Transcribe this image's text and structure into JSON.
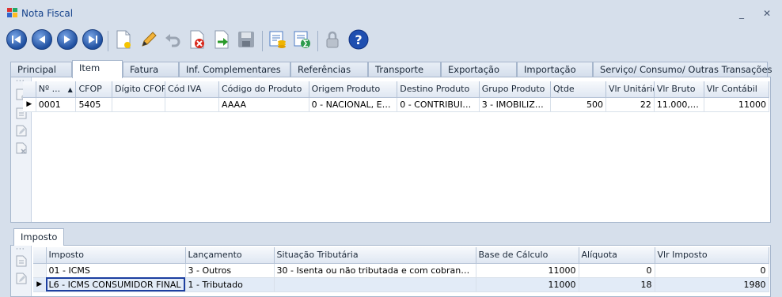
{
  "window": {
    "title": "Nota Fiscal",
    "minimize_label": "_",
    "close_label": "✕"
  },
  "toolbar": {
    "buttons": [
      "first-record",
      "previous-record",
      "next-record",
      "last-record",
      "new-document",
      "edit",
      "undo",
      "delete",
      "refresh",
      "save",
      "report",
      "report-export",
      "lock",
      "help"
    ]
  },
  "tabs": [
    "Principal",
    "Item",
    "Fatura",
    "Inf. Complementares",
    "Referências",
    "Transporte",
    "Exportação",
    "Importação",
    "Serviço/ Consumo/ Outras Transações"
  ],
  "active_tab": "Item",
  "items_grid": {
    "columns": [
      "Nº ...",
      "CFOP",
      "Dígito CFOP",
      "Cód IVA",
      "Código do Produto",
      "Origem Produto",
      "Destino Produto",
      "Grupo Produto",
      "Qtde",
      "Vlr Unitário",
      "Vlr Bruto",
      "Vlr Contábil"
    ],
    "sort_indicator": "▲",
    "rows": [
      {
        "marker": "▶",
        "cells": [
          "0001",
          "5405",
          "",
          "",
          "AAAA",
          "0 - NACIONAL, EX...",
          "0 - CONTRIBUIN...",
          "3 - IMOBILIZADO",
          "500",
          "22",
          "11.000,00",
          "11000"
        ]
      }
    ]
  },
  "sub_tab": "Imposto",
  "tax_grid": {
    "columns": [
      "Imposto",
      "Lançamento",
      "Situação Tributária",
      "Base de Cálculo",
      "Alíquota",
      "Vlr Imposto"
    ],
    "rows": [
      {
        "marker": "",
        "cells": [
          "01 - ICMS",
          "3 - Outros",
          "30 - Isenta ou não tributada e com cobrança do I...",
          "11000",
          "0",
          "0"
        ]
      },
      {
        "marker": "▶",
        "cells": [
          "L6 - ICMS CONSUMIDOR FINAL",
          "1 - Tributado",
          "",
          "11000",
          "18",
          "1980"
        ]
      }
    ]
  },
  "colors": {
    "title_text": "#15428b",
    "accent": "#1c3fa0",
    "tab_border": "#a6b6cc"
  }
}
